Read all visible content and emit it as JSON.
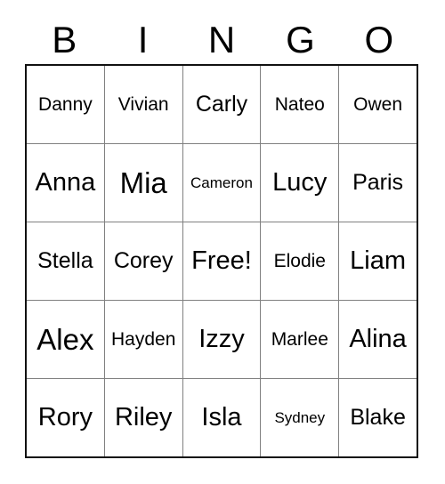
{
  "card": {
    "header_letters": [
      "B",
      "I",
      "N",
      "G",
      "O"
    ],
    "rows": [
      [
        {
          "text": "Danny",
          "size": "sm"
        },
        {
          "text": "Vivian",
          "size": "sm"
        },
        {
          "text": "Carly",
          "size": "md"
        },
        {
          "text": "Nateo",
          "size": "sm"
        },
        {
          "text": "Owen",
          "size": "sm"
        }
      ],
      [
        {
          "text": "Anna",
          "size": "lg"
        },
        {
          "text": "Mia",
          "size": "xl"
        },
        {
          "text": "Cameron",
          "size": "xs"
        },
        {
          "text": "Lucy",
          "size": "lg"
        },
        {
          "text": "Paris",
          "size": "md"
        }
      ],
      [
        {
          "text": "Stella",
          "size": "md"
        },
        {
          "text": "Corey",
          "size": "md"
        },
        {
          "text": "Free!",
          "size": "lg"
        },
        {
          "text": "Elodie",
          "size": "sm"
        },
        {
          "text": "Liam",
          "size": "lg"
        }
      ],
      [
        {
          "text": "Alex",
          "size": "xl"
        },
        {
          "text": "Hayden",
          "size": "sm"
        },
        {
          "text": "Izzy",
          "size": "lg"
        },
        {
          "text": "Marlee",
          "size": "sm"
        },
        {
          "text": "Alina",
          "size": "lg"
        }
      ],
      [
        {
          "text": "Rory",
          "size": "lg"
        },
        {
          "text": "Riley",
          "size": "lg"
        },
        {
          "text": "Isla",
          "size": "lg"
        },
        {
          "text": "Sydney",
          "size": "xs"
        },
        {
          "text": "Blake",
          "size": "md"
        }
      ]
    ],
    "colors": {
      "background": "#ffffff",
      "text": "#000000",
      "outer_border": "#111111",
      "inner_grid_line": "#808080"
    }
  }
}
